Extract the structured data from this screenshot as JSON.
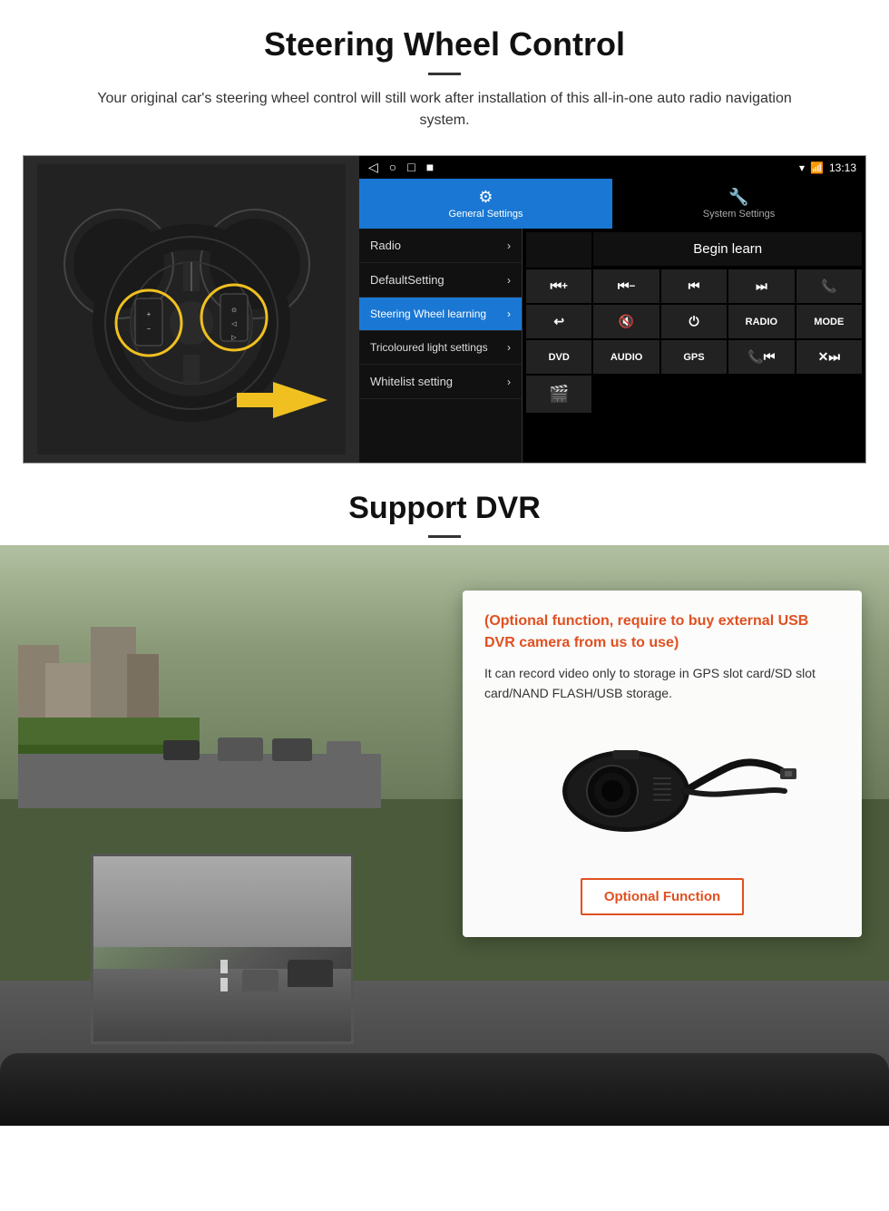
{
  "page": {
    "section1": {
      "title": "Steering Wheel Control",
      "description": "Your original car's steering wheel control will still work after installation of this all-in-one auto radio navigation system.",
      "statusbar": {
        "time": "13:13",
        "nav_back": "◁",
        "nav_home": "○",
        "nav_square": "□",
        "nav_menu": "■"
      },
      "tabs": [
        {
          "id": "general",
          "icon": "⚙",
          "label": "General Settings",
          "active": true
        },
        {
          "id": "system",
          "icon": "🔧",
          "label": "System Settings",
          "active": false
        }
      ],
      "menu_items": [
        {
          "label": "Radio",
          "active": false
        },
        {
          "label": "DefaultSetting",
          "active": false
        },
        {
          "label": "Steering Wheel learning",
          "active": true
        },
        {
          "label": "Tricoloured light settings",
          "active": false
        },
        {
          "label": "Whitelist setting",
          "active": false
        }
      ],
      "begin_learn_label": "Begin learn",
      "control_buttons": [
        "⏮+",
        "⏮−",
        "⏮⏮",
        "⏭⏭",
        "📞",
        "↩",
        "🔇×",
        "⏻",
        "RADIO",
        "MODE",
        "DVD",
        "AUDIO",
        "GPS",
        "📞⏮",
        "✕⏭",
        "📷"
      ]
    },
    "section2": {
      "title": "Support DVR",
      "card": {
        "optional_highlight": "(Optional function, require to buy external USB DVR camera from us to use)",
        "description": "It can record video only to storage in GPS slot card/SD slot card/NAND FLASH/USB storage.",
        "button_label": "Optional Function"
      }
    }
  }
}
